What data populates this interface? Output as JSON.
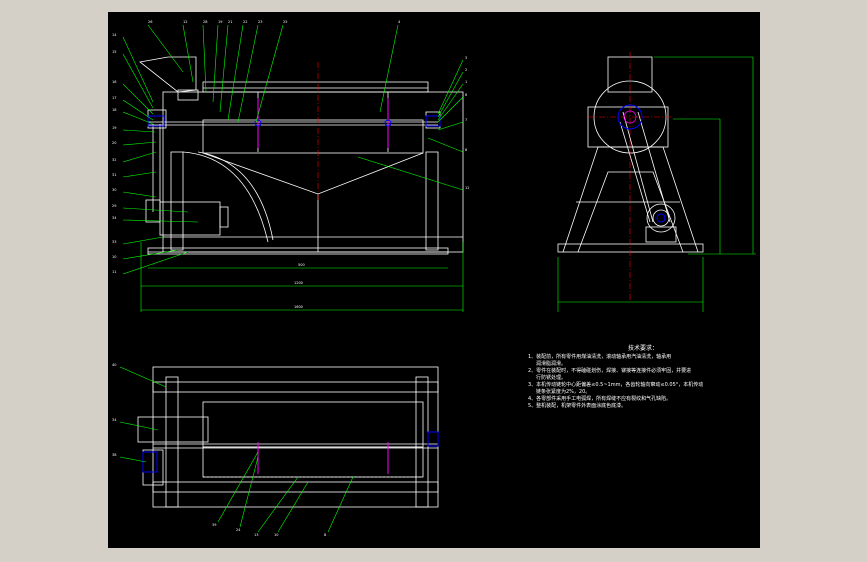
{
  "colors": {
    "frame_background": "#d4d0c8",
    "drawing_background": "#000000",
    "outline": "#ffffff",
    "leader": "#00ff00",
    "centerline": "#ff0000",
    "hatch": "#ff00ff",
    "detail": "#0000ff"
  },
  "notes": {
    "title": "技术要求：",
    "items": [
      "1、装配前，所有零件用煤油清洗，滚动轴承用汽油清洗，轴承用",
      "润滑脂润滑。",
      "2、零件在装配时，不得磕碰划伤，焊接、铆接等连接件必须牢固，并要进",
      "行防锈处理。",
      "3、本机传动链轮中心距偏差≤0.5~1mm，各齿轮轴向窜动≤0.05°，本机传动",
      "链条张紧度为2%，20。",
      "4、各零部件采用手工电弧焊，所有焊缝不应有裂纹和气孔缺陷。",
      "5、整机装配，机架零件外表面涂底色底漆。"
    ]
  },
  "balloons": {
    "top_front": [
      "26",
      "12",
      "28",
      "19",
      "21",
      "22",
      "23",
      "25",
      "4",
      "3",
      "2",
      "1",
      "6",
      "7",
      "8"
    ],
    "left_front": [
      "14",
      "15",
      "16",
      "17",
      "18",
      "19",
      "20",
      "32",
      "31",
      "30",
      "29",
      "34",
      "33",
      "10",
      "11",
      "12"
    ],
    "plan": [
      "40",
      "34",
      "38",
      "39",
      "24",
      "13",
      "10",
      "8"
    ],
    "dims": [
      "500",
      "1200",
      "1600"
    ]
  }
}
